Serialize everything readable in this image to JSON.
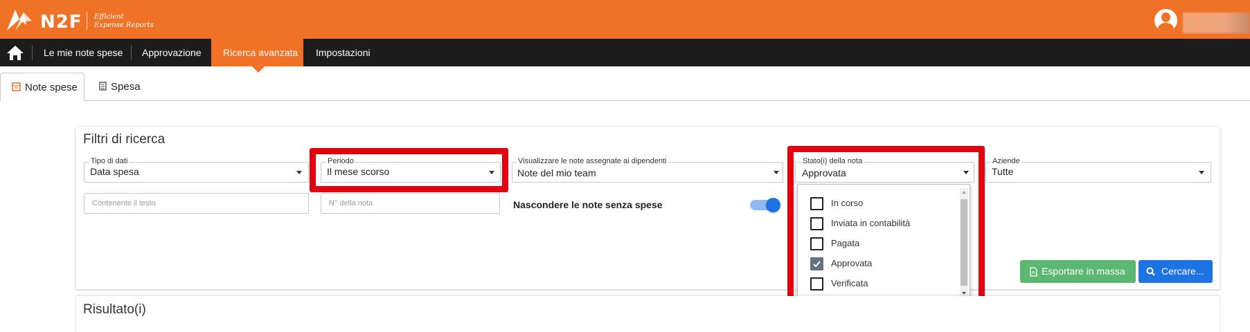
{
  "header": {
    "brand": "N2F",
    "tagline_line1": "Efficient",
    "tagline_line2": "Expense Reports",
    "accent_color": "#f07226"
  },
  "nav": {
    "items": [
      "Le mie note spese",
      "Approvazione",
      "Ricerca avanzata",
      "Impostazioni"
    ],
    "active": "Ricerca avanzata"
  },
  "tabs": [
    {
      "label": "Note spese",
      "icon": "receipt-icon",
      "active": true
    },
    {
      "label": "Spesa",
      "icon": "document-icon",
      "active": false
    }
  ],
  "filters": {
    "title": "Filtri di ricerca",
    "tipo_dati": {
      "label": "Tipo di dati",
      "value": "Data spesa"
    },
    "periodo": {
      "label": "Periodo",
      "value": "Il mese scorso"
    },
    "visualizzare": {
      "label": "Visualizzare le note assegnate ai dipendenti",
      "value": "Note del mio team"
    },
    "stato": {
      "label": "Stato(i) della nota",
      "value": "Approvata"
    },
    "aziende": {
      "label": "Aziende",
      "value": "Tutte"
    },
    "text_placeholder": "Contenente il testo",
    "number_placeholder": "N° della nota",
    "toggle_label": "Nascondere le note senza spese",
    "toggle_on": true
  },
  "stato_options": [
    {
      "label": "In corso",
      "checked": false
    },
    {
      "label": "Inviata in contabilità",
      "checked": false
    },
    {
      "label": "Pagata",
      "checked": false
    },
    {
      "label": "Approvata",
      "checked": true
    },
    {
      "label": "Verificata",
      "checked": false
    }
  ],
  "buttons": {
    "export": "Esportare in massa",
    "search": "Cercare..."
  },
  "result": {
    "title": "Risultato(i)"
  },
  "colors": {
    "highlight": "#e3000f",
    "export_btn": "#5bb870",
    "search_btn": "#1e73e3"
  }
}
